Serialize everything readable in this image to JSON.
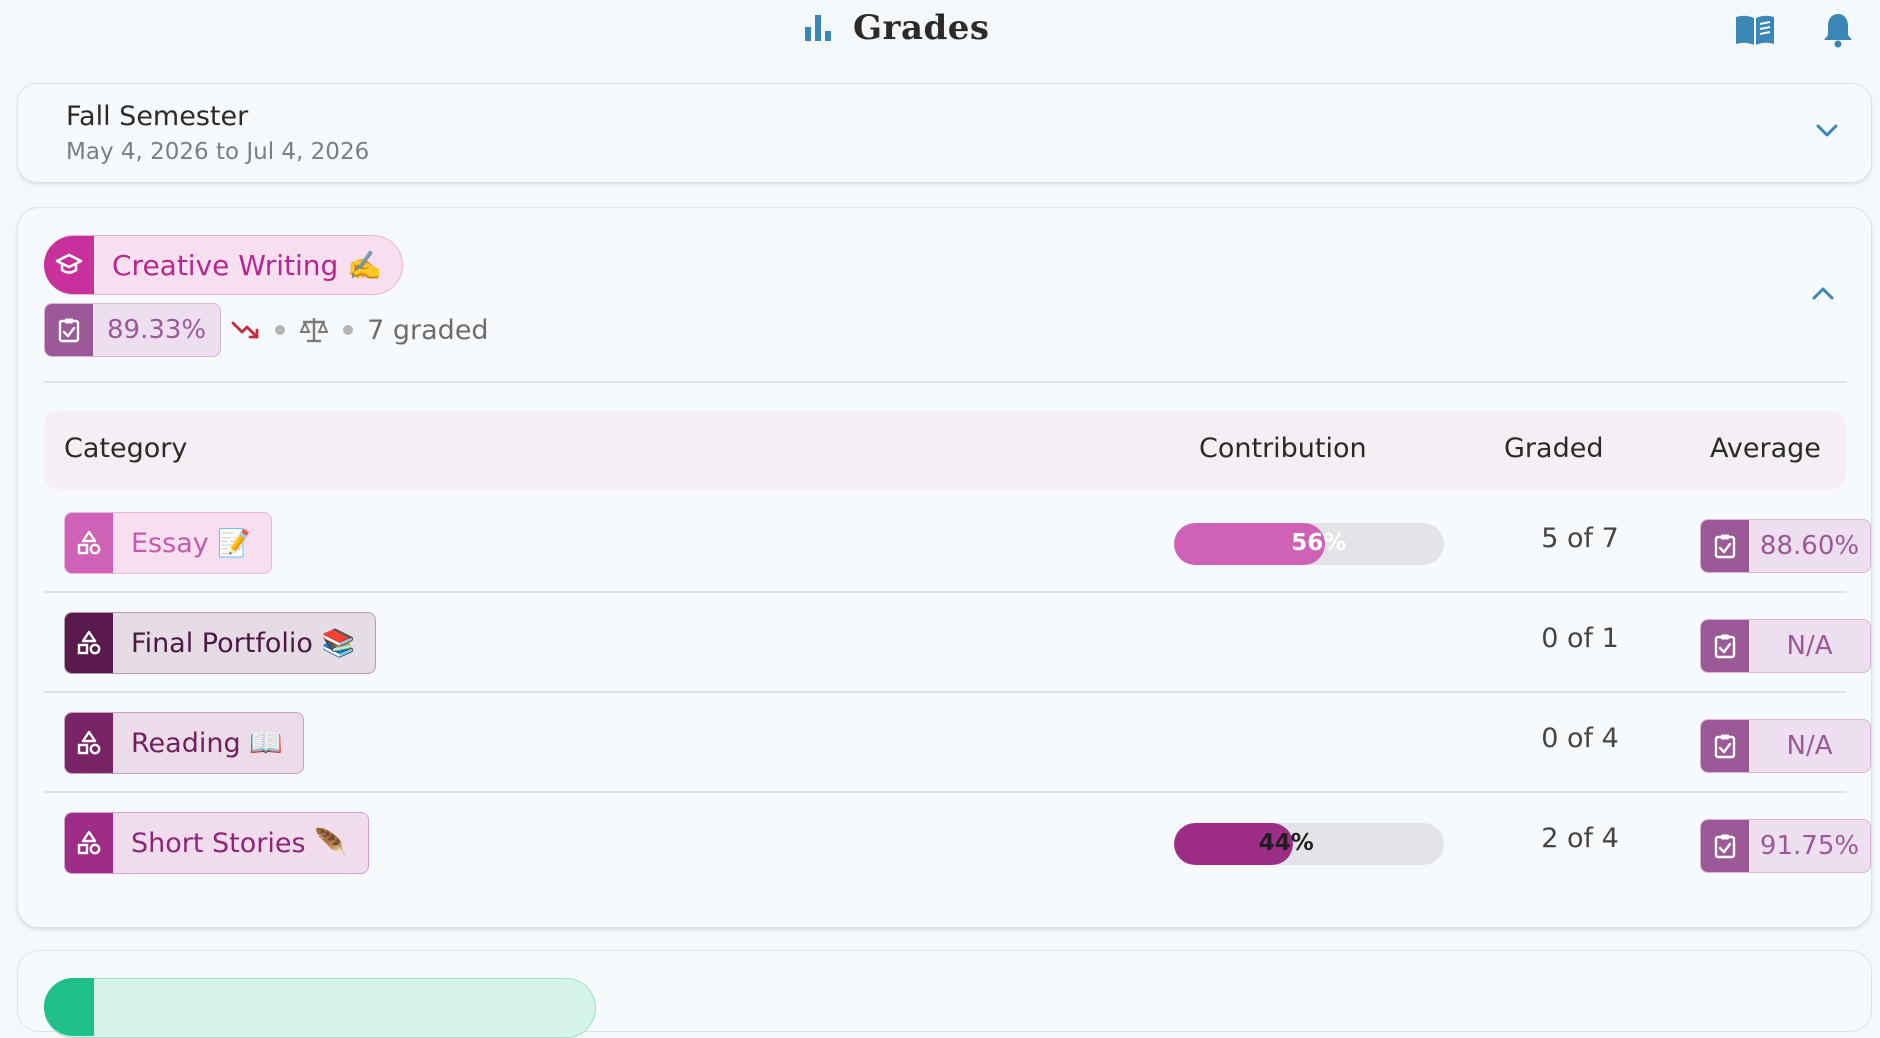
{
  "header": {
    "title": "Grades"
  },
  "semester": {
    "name": "Fall Semester",
    "dates": "May 4, 2026 to Jul 4, 2026"
  },
  "course": {
    "name": "Creative Writing ✍️",
    "color": "#c8319b",
    "average": "89.33%",
    "trend": "down",
    "graded": "7 graded"
  },
  "table": {
    "headers": {
      "category": "Category",
      "contribution": "Contribution",
      "graded": "Graded",
      "average": "Average"
    },
    "rows": [
      {
        "name": "Essay 📝",
        "color": "#cf62b6",
        "chip_bg": "#f7dff0",
        "text_color": "#c35aac",
        "contribution": 0.56,
        "contribution_label": "56%",
        "graded": "5 of 7",
        "average": "88.60%"
      },
      {
        "name": "Final Portfolio 📚",
        "color": "#5a1a4e",
        "chip_bg": "#e6dce6",
        "text_color": "#4d1743",
        "contribution": null,
        "contribution_label": "",
        "graded": "0 of 1",
        "average": "N/A"
      },
      {
        "name": "Reading 📖",
        "color": "#7a2468",
        "chip_bg": "#ecdce9",
        "text_color": "#6e1f5e",
        "contribution": null,
        "contribution_label": "",
        "graded": "0 of 4",
        "average": "N/A"
      },
      {
        "name": "Short Stories 🪶",
        "color": "#9e2d88",
        "chip_bg": "#f0dcec",
        "text_color": "#8d2578",
        "contribution": 0.44,
        "contribution_label": "44%",
        "graded": "2 of 4",
        "average": "91.75%"
      }
    ]
  },
  "next_course": {
    "color": "#1fbf8a"
  }
}
